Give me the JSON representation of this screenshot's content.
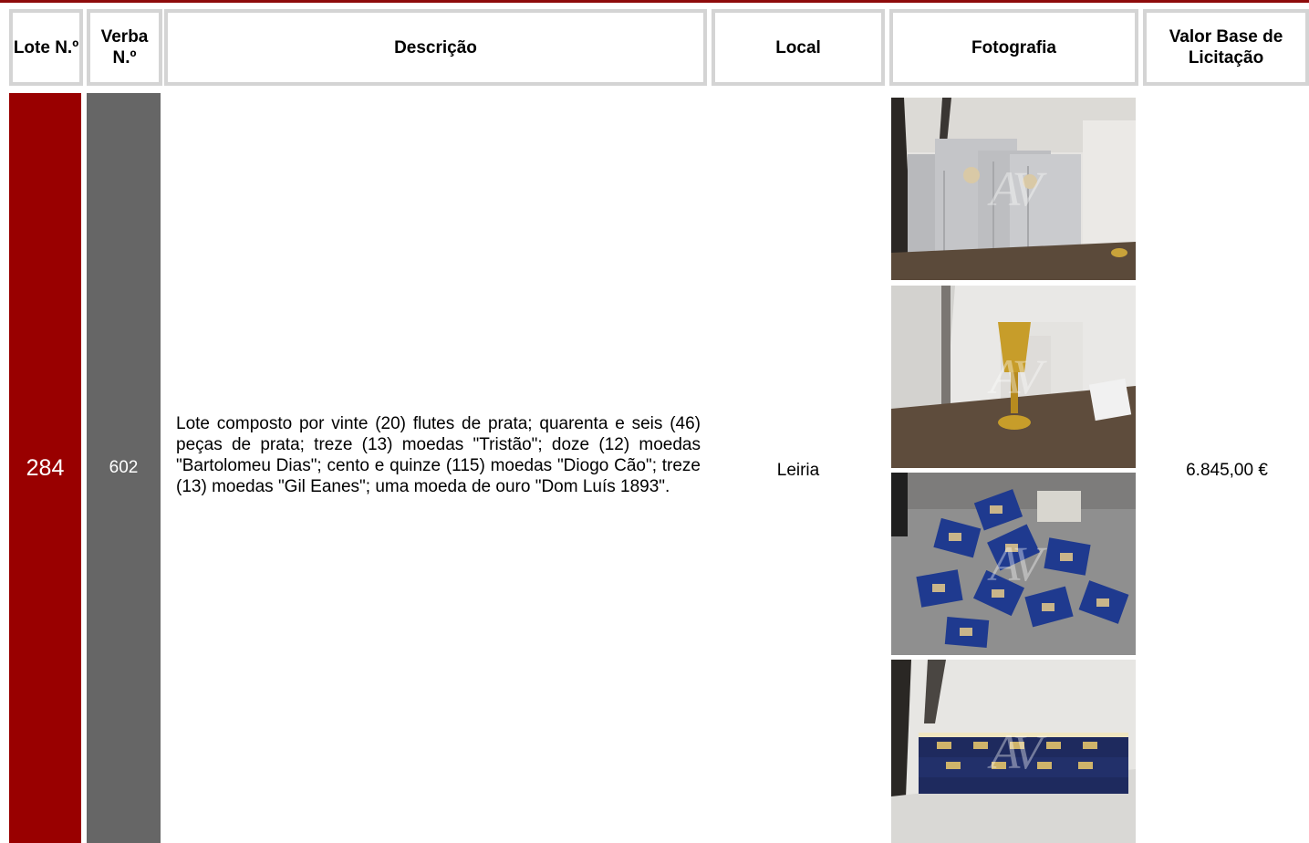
{
  "header": {
    "lote": "Lote N.º",
    "verba": "Verba N.º",
    "descricao": "Descrição",
    "local": "Local",
    "fotografia": "Fotografia",
    "valor": "Valor Base de Licitação"
  },
  "row": {
    "lote": "284",
    "verba": "602",
    "descricao": "Lote composto por vinte (20) flutes de prata; quarenta e seis (46) peças de prata; treze (13) moedas \"Tristão\"; doze (12) moedas \"Bartolomeu Dias\"; cento e quinze (115) moedas \"Diogo Cão\"; treze (13) moedas \"Gil Eanes\"; uma moeda de ouro \"Dom Luís 1893\".",
    "local": "Leiria",
    "valor": "6.845,00 €",
    "photos": [
      {
        "subject": "silver-gift-boxes-on-shelf-photo"
      },
      {
        "subject": "gold-chalice-and-boxes-photo"
      },
      {
        "subject": "blue-coin-cases-on-floor-photo"
      },
      {
        "subject": "stacked-blue-coin-cases-photo"
      }
    ]
  },
  "colors": {
    "lote_column": "#990000",
    "verba_column": "#666666",
    "header_border": "#d4d4d4",
    "top_line": "#8e0b0b"
  }
}
